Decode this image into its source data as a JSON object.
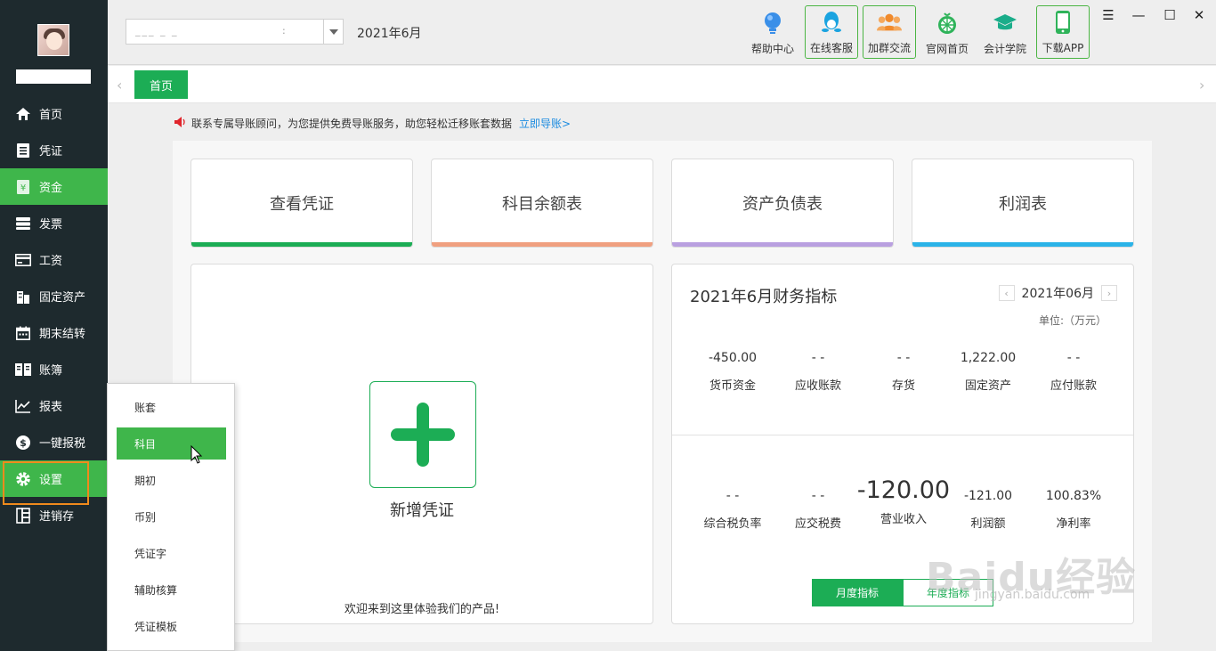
{
  "sidebar": {
    "items": [
      {
        "label": "首页",
        "icon": "home-icon"
      },
      {
        "label": "凭证",
        "icon": "voucher-icon"
      },
      {
        "label": "资金",
        "icon": "yen-icon"
      },
      {
        "label": "发票",
        "icon": "invoice-icon"
      },
      {
        "label": "工资",
        "icon": "salary-card-icon"
      },
      {
        "label": "固定资产",
        "icon": "building-icon"
      },
      {
        "label": "期末结转",
        "icon": "calendar-icon"
      },
      {
        "label": "账簿",
        "icon": "book-icon"
      },
      {
        "label": "报表",
        "icon": "chart-line-icon"
      },
      {
        "label": "一键报税",
        "icon": "dollar-circle-icon"
      },
      {
        "label": "设置",
        "icon": "gear-icon"
      },
      {
        "label": "进销存",
        "icon": "inventory-icon"
      }
    ]
  },
  "header": {
    "account_value": "___  _  _",
    "account_colon": ":",
    "period": "2021年6月",
    "tools": [
      {
        "label": "帮助中心",
        "icon": "lightbulb-icon"
      },
      {
        "label": "在线客服",
        "icon": "qq-penguin-icon"
      },
      {
        "label": "加群交流",
        "icon": "group-icon"
      },
      {
        "label": "官网首页",
        "icon": "lemon-icon"
      },
      {
        "label": "会计学院",
        "icon": "graduation-cap-icon"
      },
      {
        "label": "下载APP",
        "icon": "phone-icon"
      }
    ]
  },
  "tabs": {
    "home": "首页"
  },
  "notice": {
    "text": "联系专属导账顾问，为您提供免费导账服务，助您轻松迁移账套数据",
    "link": "立即导账>"
  },
  "cards": [
    {
      "label": "查看凭证",
      "color": "#1cad55"
    },
    {
      "label": "科目余额表",
      "color": "#f0a080"
    },
    {
      "label": "资产负债表",
      "color": "#b9a0e0"
    },
    {
      "label": "利润表",
      "color": "#2bb3e8"
    }
  ],
  "new_voucher": {
    "label": "新增凭证",
    "welcome": "欢迎来到这里体验我们的产品!"
  },
  "finance": {
    "title": "2021年6月财务指标",
    "period": "2021年06月",
    "unit": "单位:（万元）",
    "row1": [
      {
        "value": "-450.00",
        "label": "货币资金"
      },
      {
        "value": "- -",
        "label": "应收账款"
      },
      {
        "value": "- -",
        "label": "存货"
      },
      {
        "value": "1,222.00",
        "label": "固定资产"
      },
      {
        "value": "- -",
        "label": "应付账款"
      }
    ],
    "row2": [
      {
        "value": "- -",
        "label": "综合税负率"
      },
      {
        "value": "- -",
        "label": "应交税费"
      },
      {
        "value": "-120.00",
        "label": "营业收入"
      },
      {
        "value": "-121.00",
        "label": "利润额"
      },
      {
        "value": "100.83%",
        "label": "净利率"
      }
    ],
    "toggle_month": "月度指标",
    "toggle_year": "年度指标"
  },
  "flyout": {
    "items": [
      "账套",
      "科目",
      "期初",
      "币别",
      "凭证字",
      "辅助核算",
      "凭证模板"
    ]
  },
  "watermark": {
    "main": "Baidu经验",
    "sub": "jingyan.baidu.com"
  },
  "colors": {
    "sidebar_bg": "#1e2a2e",
    "accent_green": "#3fb64b",
    "brand_green": "#1cad55",
    "highlight_orange": "#f08a1c",
    "link_blue": "#1a8be0"
  }
}
